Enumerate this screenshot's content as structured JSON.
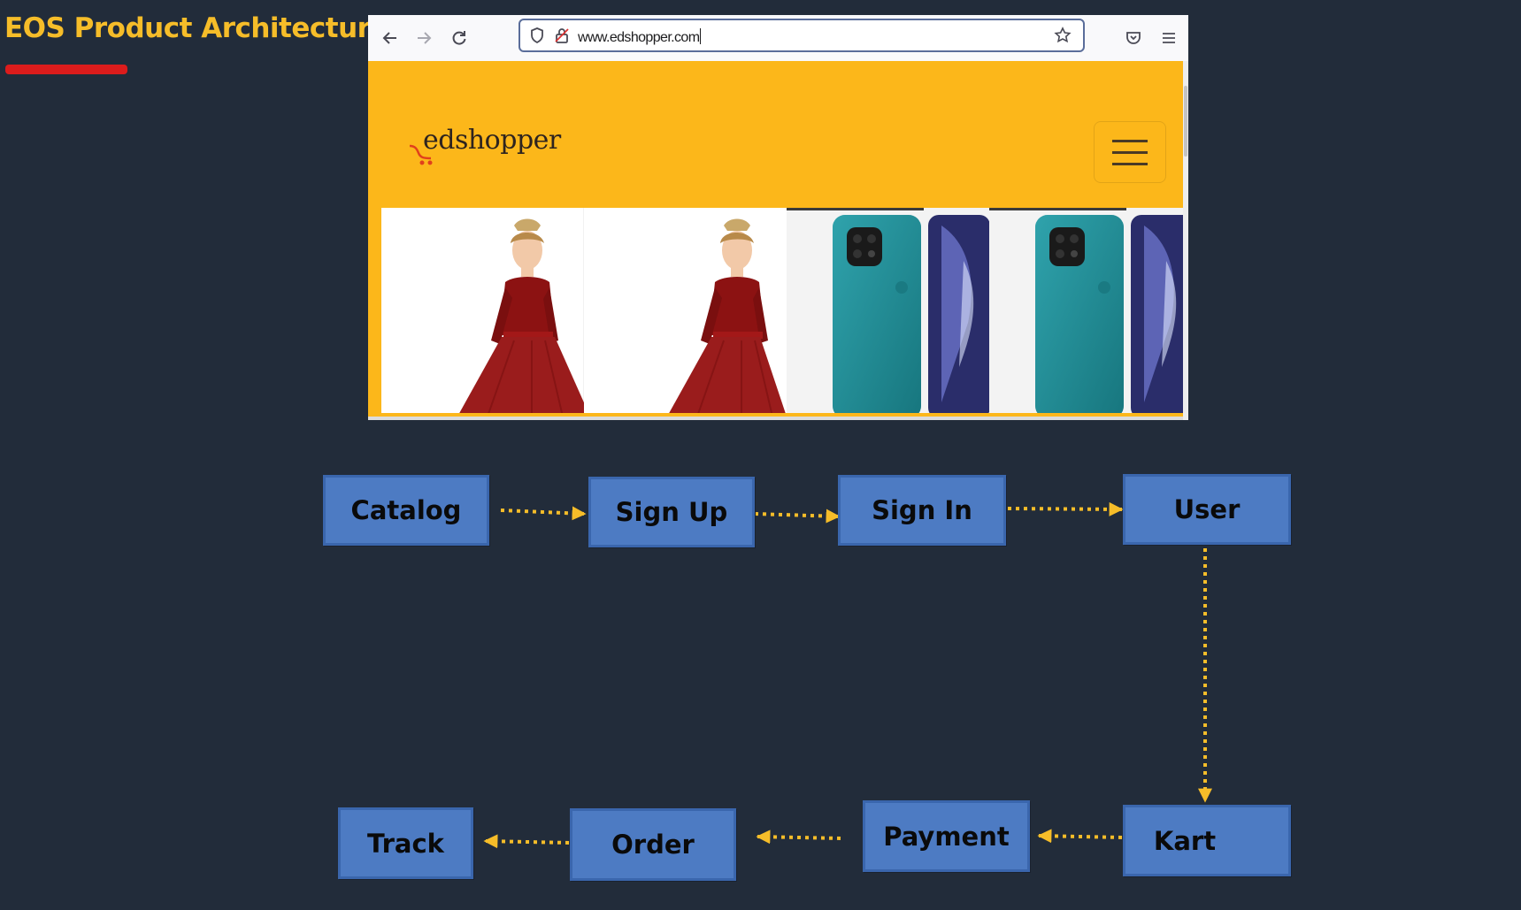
{
  "title": "EOS Product Architecture",
  "browser": {
    "url": "www.edshopper.com",
    "icons": [
      "back-arrow-icon",
      "forward-arrow-icon",
      "reload-icon",
      "shield-icon",
      "lock-icon",
      "star-icon",
      "pocket-icon",
      "hamburger-menu-icon"
    ]
  },
  "site": {
    "logo_text": "edshopper",
    "header_color": "#fcb71a",
    "products": [
      {
        "kind": "dress"
      },
      {
        "kind": "dress"
      },
      {
        "kind": "phone"
      },
      {
        "kind": "phone"
      }
    ]
  },
  "flow": {
    "nodes": [
      {
        "id": "catalog",
        "label": "Catalog"
      },
      {
        "id": "signup",
        "label": "Sign Up"
      },
      {
        "id": "signin",
        "label": "Sign In"
      },
      {
        "id": "user",
        "label": "User"
      },
      {
        "id": "kart",
        "label": "Kart"
      },
      {
        "id": "payment",
        "label": "Payment"
      },
      {
        "id": "order",
        "label": "Order"
      },
      {
        "id": "track",
        "label": "Track"
      }
    ],
    "edges": [
      {
        "from": "catalog",
        "to": "signup"
      },
      {
        "from": "signup",
        "to": "signin"
      },
      {
        "from": "signin",
        "to": "user"
      },
      {
        "from": "user",
        "to": "kart"
      },
      {
        "from": "kart",
        "to": "payment"
      },
      {
        "from": "payment",
        "to": "order"
      },
      {
        "from": "order",
        "to": "track"
      }
    ],
    "box_color": "#4d7bc3",
    "arrow_color": "#f6bd29"
  }
}
